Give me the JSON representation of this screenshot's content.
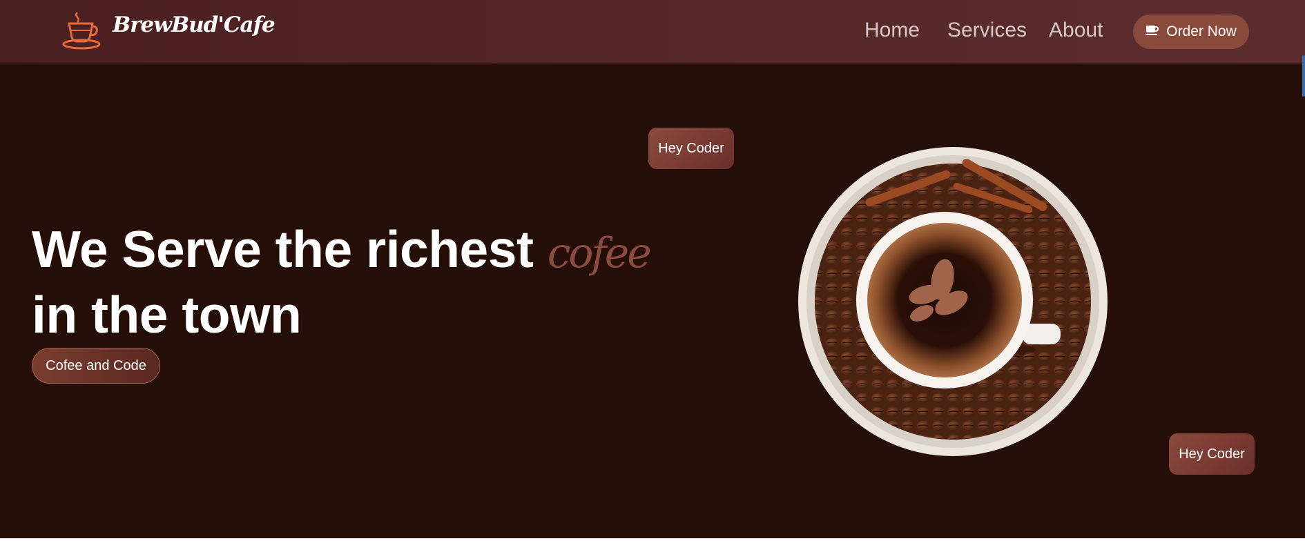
{
  "header": {
    "logo_text": "BrewBud'Cafe",
    "nav": [
      "Home",
      "Services",
      "About"
    ],
    "order_label": "Order Now"
  },
  "hero": {
    "headline_part1": "We Serve the richest ",
    "headline_accent": "cofee",
    "headline_part2": "in the town",
    "cta_label": "Cofee and Code",
    "tag_top": "Hey Coder",
    "tag_bottom": "Hey Coder"
  },
  "icons": {
    "logo": "coffee-cup-icon",
    "order": "cup-icon",
    "hero_image": "coffee-cup-on-beans"
  },
  "colors": {
    "nav_bg": "#4a1f1f",
    "hero_bg": "#250e07",
    "accent": "#8a4c3e",
    "button": "#8a4a3b",
    "logo_icon": "#e86a3a"
  }
}
